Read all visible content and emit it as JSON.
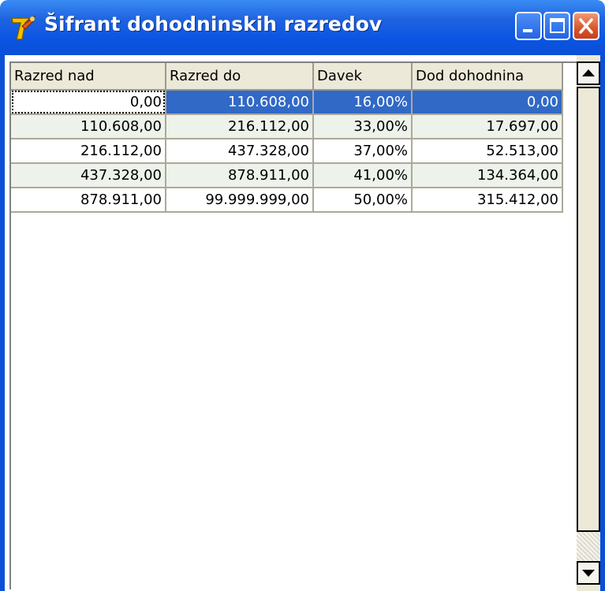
{
  "window": {
    "title": "Šifrant dohodninskih razredov",
    "icon": "app-logo-icon",
    "titlebar_color": "#0a4fd6"
  },
  "titlebar_buttons": {
    "minimize": "minimize-icon",
    "maximize": "maximize-icon",
    "close": "close-icon"
  },
  "grid": {
    "columns": [
      "Razred nad",
      "Razred do",
      "Davek",
      "Dod dohodnina"
    ],
    "rows": [
      [
        "0,00",
        "110.608,00",
        "16,00%",
        "0,00"
      ],
      [
        "110.608,00",
        "216.112,00",
        "33,00%",
        "17.697,00"
      ],
      [
        "216.112,00",
        "437.328,00",
        "37,00%",
        "52.513,00"
      ],
      [
        "437.328,00",
        "878.911,00",
        "41,00%",
        "134.364,00"
      ],
      [
        "878.911,00",
        "99.999.999,00",
        "50,00%",
        "315.412,00"
      ]
    ],
    "selection_color": "#3169c6",
    "alt_row_color": "#edf3ea"
  },
  "scrollbar": {
    "up": "scroll-up-arrow-icon",
    "down": "scroll-down-arrow-icon"
  }
}
